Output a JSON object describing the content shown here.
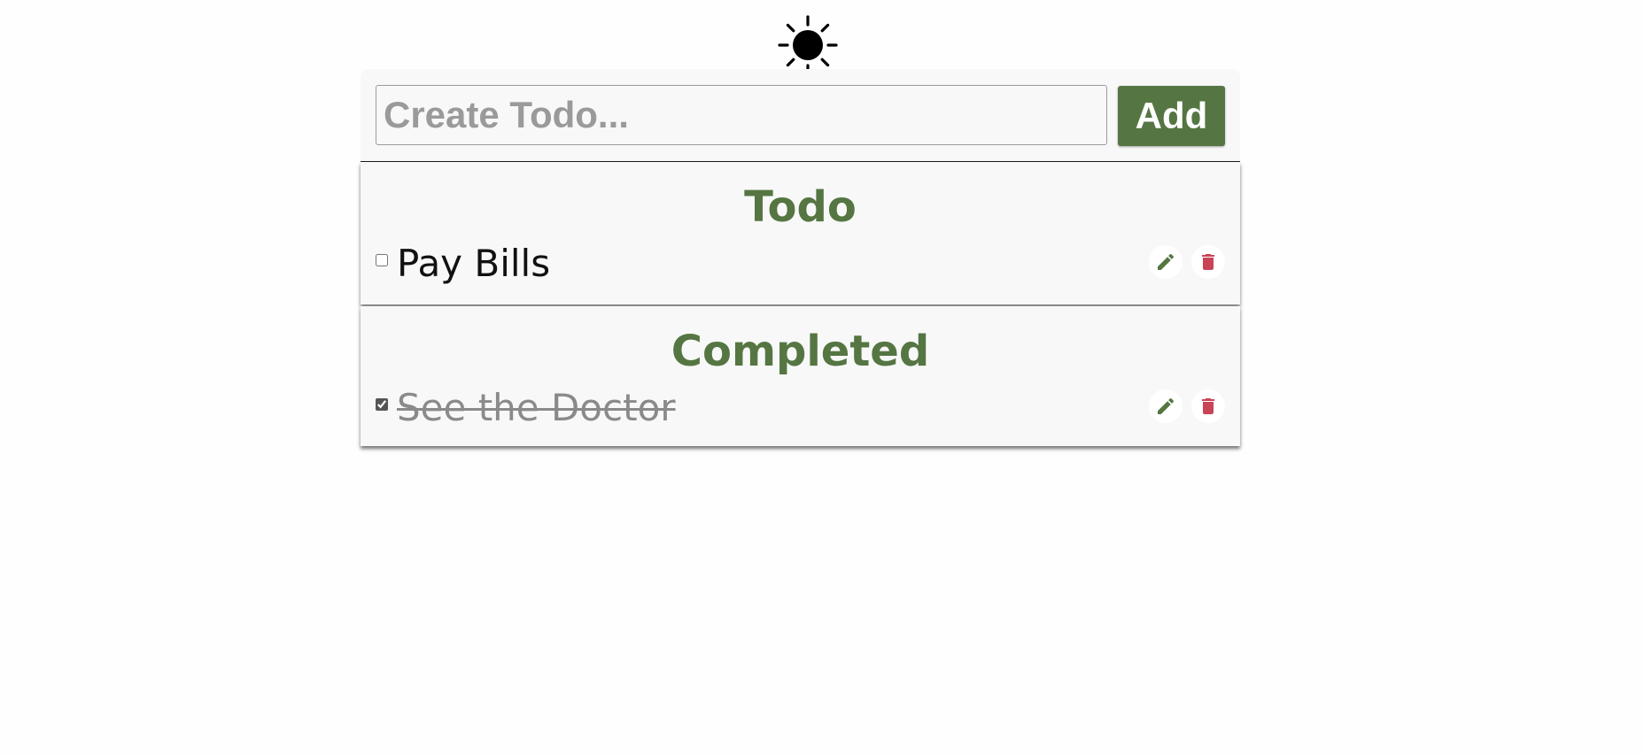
{
  "theme_toggle": {
    "icon": "sun-icon"
  },
  "create": {
    "placeholder": "Create Todo...",
    "value": "",
    "add_label": "Add"
  },
  "sections": {
    "todo": {
      "title": "Todo",
      "items": [
        {
          "text": "Pay Bills",
          "checked": false,
          "edit_icon": "pencil-icon",
          "delete_icon": "trash-icon"
        }
      ]
    },
    "completed": {
      "title": "Completed",
      "items": [
        {
          "text": "See the Doctor",
          "checked": true,
          "edit_icon": "pencil-icon",
          "delete_icon": "trash-icon"
        }
      ]
    }
  },
  "colors": {
    "accent": "#557642",
    "delete": "#c94456",
    "panel": "#f8f8f8",
    "completed_text": "#8a8a8a"
  }
}
